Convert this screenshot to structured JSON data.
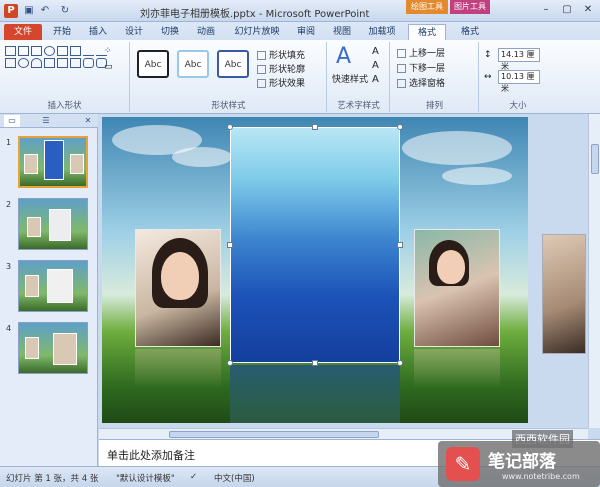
{
  "titlebar": {
    "app_icon_glyph": "P",
    "title": "刘亦菲电子相册模板.pptx - Microsoft PowerPoint",
    "contextual_tabs": [
      "绘图工具",
      "图片工具"
    ],
    "quick_access": {
      "save": "▣",
      "undo": "↶",
      "redo": "↻"
    }
  },
  "tabs": {
    "file": "文件",
    "items": [
      "开始",
      "插入",
      "设计",
      "切换",
      "动画",
      "幻灯片放映",
      "审阅",
      "视图",
      "加载项",
      "格式",
      "格式"
    ]
  },
  "ribbon": {
    "insert_shapes": {
      "label": "插入形状"
    },
    "shape_styles": {
      "label": "形状样式",
      "style_samples": [
        "Abc",
        "Abc",
        "Abc"
      ],
      "fill": "形状填充",
      "outline": "形状轮廓",
      "effects": "形状效果"
    },
    "wordart": {
      "label": "艺术字样式",
      "quick_styles": "快速样式"
    },
    "arrange": {
      "label": "排列",
      "bring_forward": "上移一层",
      "send_backward": "下移一层",
      "selection_pane": "选择窗格"
    },
    "size": {
      "label": "大小",
      "height": "14.13 厘米",
      "width": "10.13 厘米"
    }
  },
  "slides_pane": {
    "tab_icons": [
      "▭",
      "☰"
    ],
    "close": "✕",
    "thumbnails": [
      {
        "number": "1",
        "selected": true
      },
      {
        "number": "2",
        "selected": false
      },
      {
        "number": "3",
        "selected": false
      },
      {
        "number": "4",
        "selected": false
      }
    ]
  },
  "notes": {
    "placeholder": "单击此处添加备注"
  },
  "status_bar": {
    "slide_info": "幻灯片 第 1 张，共 4 张",
    "theme": "\"默认设计模板\"",
    "language": "中文(中国)"
  },
  "watermark": {
    "site": "西西软件园",
    "brand": "笔记部落",
    "url": "www.notetribe.com"
  }
}
